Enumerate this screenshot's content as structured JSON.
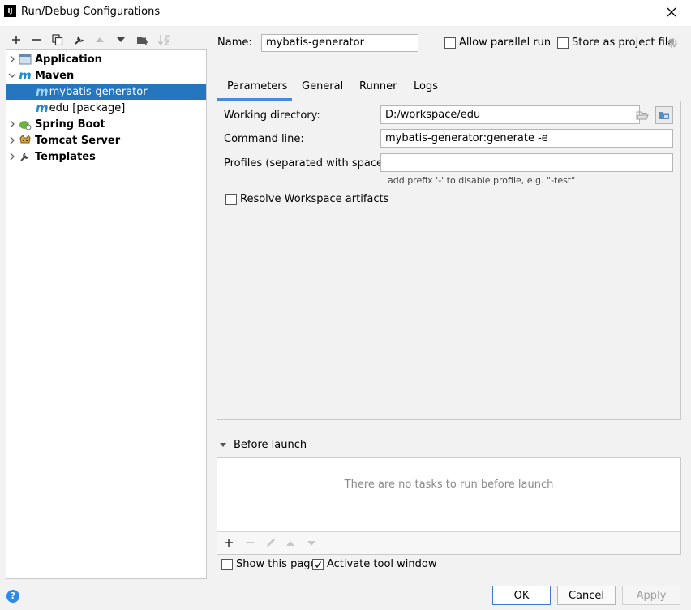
{
  "window": {
    "title": "Run/Debug Configurations",
    "app_icon_text": "IJ"
  },
  "tree": {
    "items": [
      {
        "label": "Application",
        "icon": "application-icon",
        "expanded": false
      },
      {
        "label": "Maven",
        "icon": "maven-icon",
        "expanded": true
      },
      {
        "label": "mybatis-generator",
        "icon": "maven-config-icon",
        "selected": true
      },
      {
        "label": "edu [package]",
        "icon": "maven-config-icon"
      },
      {
        "label": "Spring Boot",
        "icon": "spring-boot-icon",
        "expanded": false
      },
      {
        "label": "Tomcat Server",
        "icon": "tomcat-icon",
        "expanded": false
      },
      {
        "label": "Templates",
        "icon": "wrench-icon",
        "expanded": false
      }
    ]
  },
  "header": {
    "name_label": "Name:",
    "name_value": "mybatis-generator",
    "allow_parallel_label": "Allow parallel run",
    "store_label": "Store as project file"
  },
  "tabs": [
    {
      "label": "Parameters",
      "active": true
    },
    {
      "label": "General"
    },
    {
      "label": "Runner"
    },
    {
      "label": "Logs"
    }
  ],
  "params": {
    "working_dir_label": "Working directory:",
    "working_dir_value": "D:/workspace/edu",
    "command_line_label": "Command line:",
    "command_line_value": "mybatis-generator:generate -e",
    "profiles_label": "Profiles (separated with space):",
    "profiles_value": "",
    "profiles_hint": "add prefix '-' to disable profile, e.g. \"-test\"",
    "resolve_label": "Resolve Workspace artifacts"
  },
  "before_launch": {
    "title": "Before launch",
    "empty_text": "There are no tasks to run before launch"
  },
  "footer": {
    "show_page_label": "Show this page",
    "activate_label": "Activate tool window",
    "ok": "OK",
    "cancel": "Cancel",
    "apply": "Apply"
  },
  "colors": {
    "selection": "#2675bf",
    "accent": "#4a8ad4",
    "help": "#2e8ae6"
  }
}
